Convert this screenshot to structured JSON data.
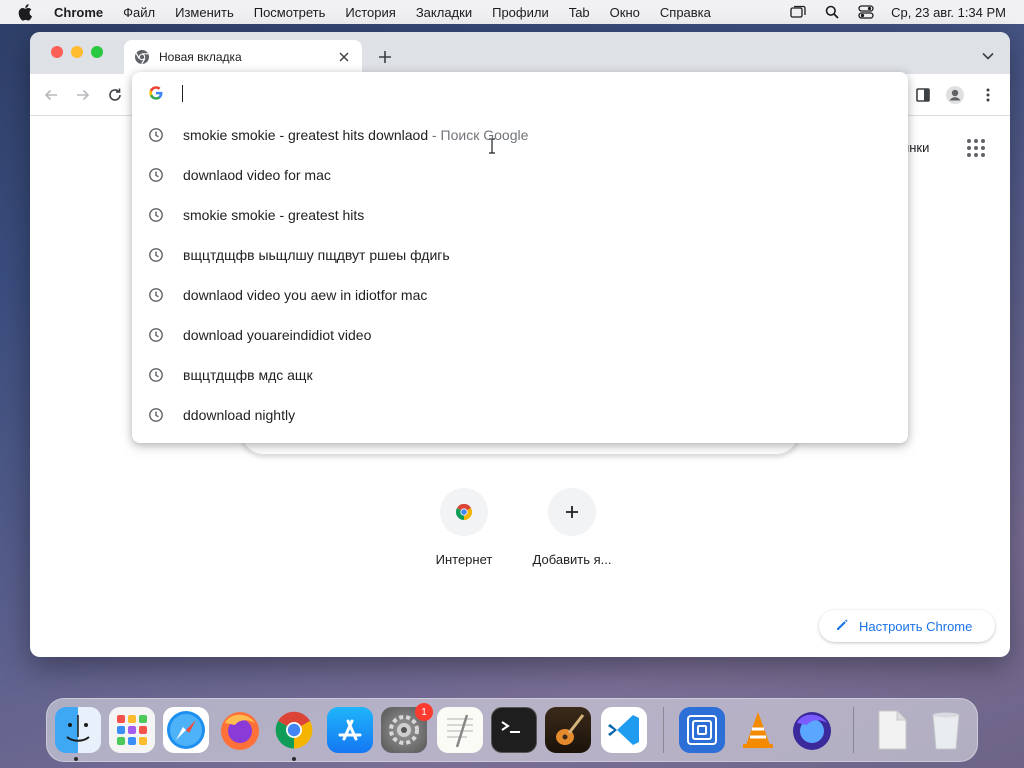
{
  "menubar": {
    "app_name": "Chrome",
    "items": [
      "Файл",
      "Изменить",
      "Посмотреть",
      "История",
      "Закладки",
      "Профили",
      "Tab",
      "Окно",
      "Справка"
    ],
    "clock": "Ср, 23 авг.  1:34 PM",
    "status_icons": [
      "window-icon",
      "search-icon",
      "control-center-icon"
    ]
  },
  "tab": {
    "title": "Новая вкладка"
  },
  "omnibox": {
    "value": "",
    "suggestions": [
      {
        "text": "smokie smokie - greatest hits downlaod",
        "suffix": " - Поиск Google"
      },
      {
        "text": "downlaod video for mac",
        "suffix": ""
      },
      {
        "text": "smokie smokie - greatest hits",
        "suffix": ""
      },
      {
        "text": "вщцтдщфв ыьщлшу пщдвут ршеы фдигь",
        "suffix": ""
      },
      {
        "text": "downlaod video you aew in idiotfor mac",
        "suffix": ""
      },
      {
        "text": "download youareindidiot video",
        "suffix": ""
      },
      {
        "text": "вщцтдщфв мдс ащк",
        "suffix": ""
      },
      {
        "text": "ddownload nightly",
        "suffix": ""
      }
    ]
  },
  "ntp": {
    "images_link": "тинки",
    "shortcuts": [
      {
        "label": "Интернет",
        "icon": "chrome-icon"
      },
      {
        "label": "Добавить я...",
        "icon": "plus-icon"
      }
    ],
    "customize_label": "Настроить Chrome"
  },
  "dock": {
    "apps": [
      "finder",
      "launchpad",
      "safari",
      "firefox",
      "chrome",
      "app-store",
      "system-settings",
      "textedit",
      "terminal",
      "garageband",
      "vscode",
      "screens",
      "vlc",
      "firefox-nightly",
      "document",
      "trash"
    ],
    "settings_badge": "1"
  },
  "colors": {
    "accent": "#1a73e8",
    "tabstrip": "#dee1e6",
    "menubar": "#f1f1f3"
  }
}
